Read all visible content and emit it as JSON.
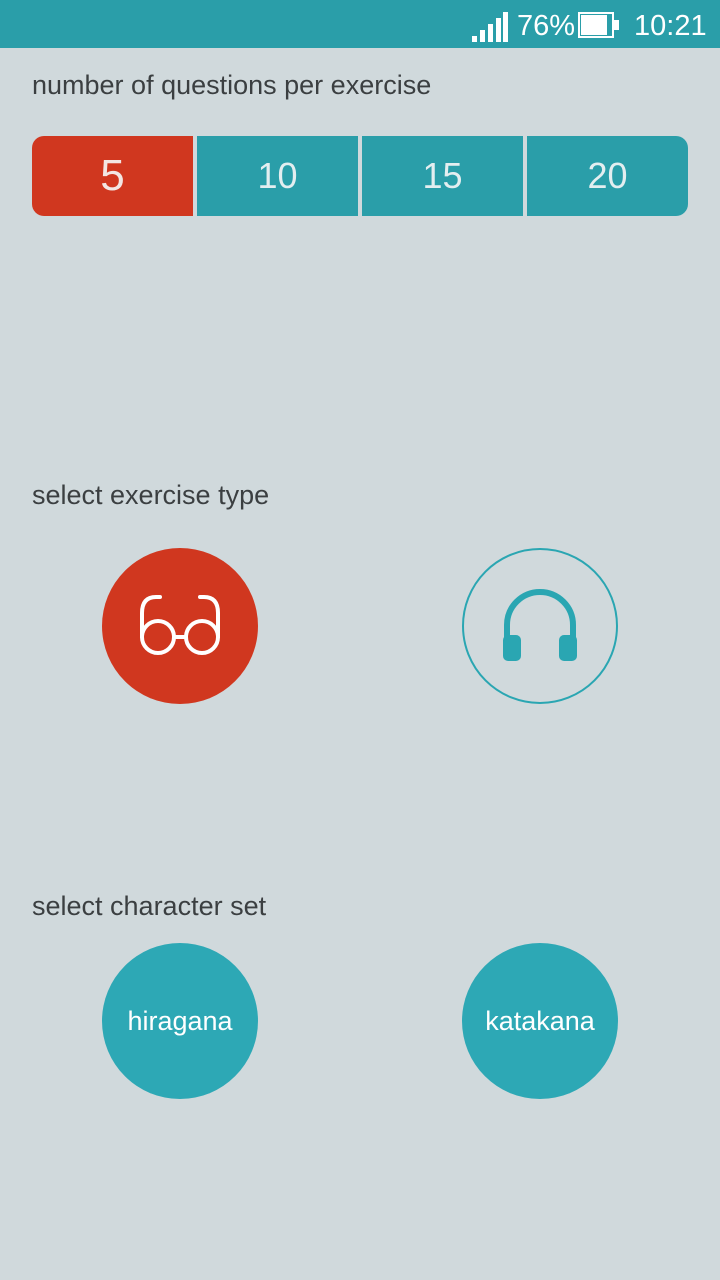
{
  "status_bar": {
    "battery_percent": "76%",
    "time": "10:21",
    "signal_icon": "signal-icon",
    "battery_icon": "battery-icon"
  },
  "questions": {
    "label": "number of questions per exercise",
    "options": [
      "5",
      "10",
      "15",
      "20"
    ],
    "selected": "5"
  },
  "exercise_type": {
    "label": "select exercise type",
    "options": [
      {
        "icon": "glasses-icon",
        "selected": true
      },
      {
        "icon": "headphones-icon",
        "selected": false
      }
    ]
  },
  "character_set": {
    "label": "select character set",
    "options": [
      "hiragana",
      "katakana"
    ]
  },
  "colors": {
    "teal": "#2a9ea9",
    "red": "#d0371f",
    "background": "#d0d9dc"
  }
}
